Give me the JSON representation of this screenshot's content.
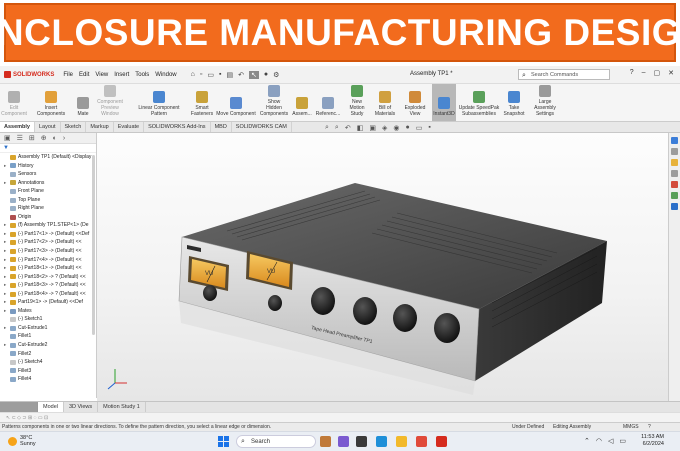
{
  "banner": {
    "title": "ENCLOSURE MANUFACTURING DESIGN"
  },
  "titlebar": {
    "app_name": "SOLIDWORKS",
    "menus": [
      "File",
      "Edit",
      "View",
      "Insert",
      "Tools",
      "Window"
    ],
    "document_title": "Assembly TP1 *",
    "search_placeholder": "Search Commands"
  },
  "command_manager": {
    "buttons": [
      {
        "label": "Edit Component",
        "icon": "edit-component-icon",
        "dim": true
      },
      {
        "label": "Insert Components",
        "icon": "insert-components-icon"
      },
      {
        "label": "Mate",
        "icon": "mate-icon"
      },
      {
        "label": "Component Preview Window",
        "icon": "preview-window-icon",
        "dim": true
      },
      {
        "label": "Linear Component Pattern",
        "icon": "linear-pattern-icon"
      },
      {
        "label": "Smart Fasteners",
        "icon": "smart-fasteners-icon"
      },
      {
        "label": "Move Component",
        "icon": "move-component-icon"
      },
      {
        "label": "Show Hidden Components",
        "icon": "show-hidden-icon"
      },
      {
        "label": "Assem...",
        "icon": "assembly-features-icon"
      },
      {
        "label": "Referenc...",
        "icon": "reference-geometry-icon"
      },
      {
        "label": "New Motion Study",
        "icon": "motion-study-icon"
      },
      {
        "label": "Bill of Materials",
        "icon": "bom-icon"
      },
      {
        "label": "Exploded View",
        "icon": "exploded-view-icon"
      },
      {
        "label": "Instant3D",
        "icon": "instant3d-icon",
        "active": true
      },
      {
        "label": "Update SpeedPak Subassemblies",
        "icon": "speedpak-icon"
      },
      {
        "label": "Take Snapshot",
        "icon": "snapshot-icon"
      },
      {
        "label": "Large Assembly Settings",
        "icon": "large-assembly-icon"
      }
    ]
  },
  "tabs": [
    "Assembly",
    "Layout",
    "Sketch",
    "Markup",
    "Evaluate",
    "SOLIDWORKS Add-Ins",
    "MBD",
    "SOLIDWORKS CAM"
  ],
  "tree": {
    "nodes": [
      {
        "text": "Assembly TP1 (Default) <Display",
        "color": "#d9a42b",
        "tw": ""
      },
      {
        "text": "History",
        "color": "#7aa0c8",
        "tw": "▸"
      },
      {
        "text": "Sensors",
        "color": "#9ab0c8",
        "tw": ""
      },
      {
        "text": "Annotations",
        "color": "#c6a63a",
        "tw": "▸"
      },
      {
        "text": "Front Plane",
        "color": "#9ab0c8",
        "tw": ""
      },
      {
        "text": "Top Plane",
        "color": "#9ab0c8",
        "tw": ""
      },
      {
        "text": "Right Plane",
        "color": "#9ab0c8",
        "tw": ""
      },
      {
        "text": "Origin",
        "color": "#b05050",
        "tw": ""
      },
      {
        "text": "(f) Assembly TP1.STEP<1> (De",
        "color": "#d9a42b",
        "tw": "▸"
      },
      {
        "text": "(-) Part17<1> -> (Default) <<Def",
        "color": "#d9a42b",
        "tw": "▸"
      },
      {
        "text": "(-) Part17<2> -> (Default) <<",
        "color": "#d9a42b",
        "tw": "▸"
      },
      {
        "text": "(-) Part17<3> -> (Default) <<",
        "color": "#d9a42b",
        "tw": "▸"
      },
      {
        "text": "(-) Part17<4> -> (Default) <<",
        "color": "#d9a42b",
        "tw": "▸"
      },
      {
        "text": "(-) Part18<1> -> (Default) <<",
        "color": "#d9a42b",
        "tw": "▸"
      },
      {
        "text": "(-) Part18<2> -> ? (Default) <<",
        "color": "#d9a42b",
        "tw": "▸"
      },
      {
        "text": "(-) Part18<3> -> ? (Default) <<",
        "color": "#d9a42b",
        "tw": "▸"
      },
      {
        "text": "(-) Part18<4> -> ? (Default) <<",
        "color": "#d9a42b",
        "tw": "▸"
      },
      {
        "text": "Part19<1> -> (Default) <<Def",
        "color": "#d9a42b",
        "tw": "▸"
      },
      {
        "text": "Mates",
        "color": "#7a9ac0",
        "tw": "▸"
      },
      {
        "text": "(-) Sketch1",
        "color": "#c8c8c8",
        "tw": ""
      },
      {
        "text": "Cut-Extrude1",
        "color": "#8aa8c8",
        "tw": "▸"
      },
      {
        "text": "Fillet1",
        "color": "#8aa8c8",
        "tw": ""
      },
      {
        "text": "Cut-Extrude2",
        "color": "#8aa8c8",
        "tw": "▸"
      },
      {
        "text": "Fillet2",
        "color": "#8aa8c8",
        "tw": ""
      },
      {
        "text": "(-) Sketch4",
        "color": "#c8c8c8",
        "tw": ""
      },
      {
        "text": "Fillet3",
        "color": "#8aa8c8",
        "tw": ""
      },
      {
        "text": "Fillet4",
        "color": "#8aa8c8",
        "tw": ""
      }
    ]
  },
  "model": {
    "faceplate_label": "Tape Head Preamplifier TP1",
    "meter_label": "VU"
  },
  "bottom_tabs": [
    "Model",
    "3D Views",
    "Motion Study 1"
  ],
  "status": {
    "hint": "Patterns components in one or two linear directions. To define the pattern direction, you select a linear edge or dimension.",
    "state1": "Under Defined",
    "state2": "Editing Assembly",
    "units": "MMGS",
    "extra": "?"
  },
  "taskbar": {
    "temp": "38°C",
    "weather": "Sunny",
    "search": "Search",
    "time": "11:53 AM",
    "date": "6/2/2024"
  }
}
